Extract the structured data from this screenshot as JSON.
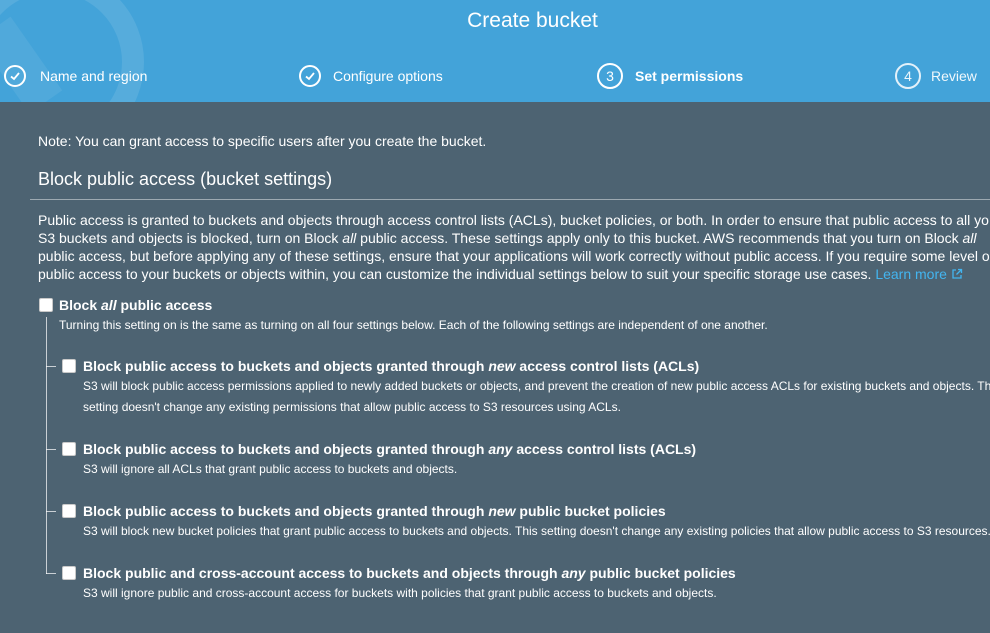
{
  "header": {
    "title": "Create bucket",
    "steps": [
      {
        "number": "✓",
        "label": "Name and region",
        "state": "done"
      },
      {
        "number": "✓",
        "label": "Configure options",
        "state": "done"
      },
      {
        "number": "3",
        "label": "Set permissions",
        "state": "active"
      },
      {
        "number": "4",
        "label": "Review",
        "state": "todo"
      }
    ]
  },
  "note": "Note: You can grant access to specific users after you create the bucket.",
  "section": {
    "title": "Block public access (bucket settings)",
    "desc_lines": [
      {
        "before": "Public access is granted to buckets and objects through access control lists (ACLs), bucket policies, or both. In order to ensure that public access to all yo",
        "em": "",
        "after": ""
      },
      {
        "before": "S3 buckets and objects is blocked, turn on Block ",
        "em": "all",
        "after": " public access. These settings apply only to this bucket. AWS recommends that you turn on Block "
      },
      {
        "before": "public access, but before applying any of these settings, ensure that your applications will work correctly without public access. If you require some level o",
        "em": "",
        "after": ""
      },
      {
        "before": "public access to your buckets or objects within, you can customize the individual settings below to suit your specific storage use cases. ",
        "em": "",
        "after": ""
      }
    ],
    "line2_trailing_em": "all",
    "learn_more": "Learn more"
  },
  "block_all": {
    "title_before": "Block ",
    "title_em": "all",
    "title_after": " public access",
    "checked": false,
    "sub": "Turning this setting on is the same as turning on all four settings below. Each of the following settings are independent of one another."
  },
  "options": [
    {
      "title_before": "Block public access to buckets and objects granted through ",
      "title_em": "new",
      "title_after": " access control lists (ACLs)",
      "checked": false,
      "sub_lines": [
        "S3 will block public access permissions applied to newly added buckets or objects, and prevent the creation of new public access ACLs for existing buckets and objects. Th",
        "setting doesn't change any existing permissions that allow public access to S3 resources using ACLs."
      ]
    },
    {
      "title_before": "Block public access to buckets and objects granted through ",
      "title_em": "any",
      "title_after": " access control lists (ACLs)",
      "checked": false,
      "sub_lines": [
        "S3 will ignore all ACLs that grant public access to buckets and objects."
      ]
    },
    {
      "title_before": "Block public access to buckets and objects granted through ",
      "title_em": "new",
      "title_after": " public bucket policies",
      "checked": false,
      "sub_lines": [
        "S3 will block new bucket policies that grant public access to buckets and objects. This setting doesn't change any existing policies that allow public access to S3 resources."
      ]
    },
    {
      "title_before": "Block public and cross-account access to buckets and objects through ",
      "title_em": "any",
      "title_after": " public bucket policies",
      "checked": false,
      "sub_lines": [
        "S3 will ignore public and cross-account access for buckets with policies that grant public access to buckets and objects."
      ]
    }
  ],
  "colors": {
    "header_bg": "#43a3d9",
    "page_bg": "#4d6372",
    "link": "#43b5f0"
  }
}
